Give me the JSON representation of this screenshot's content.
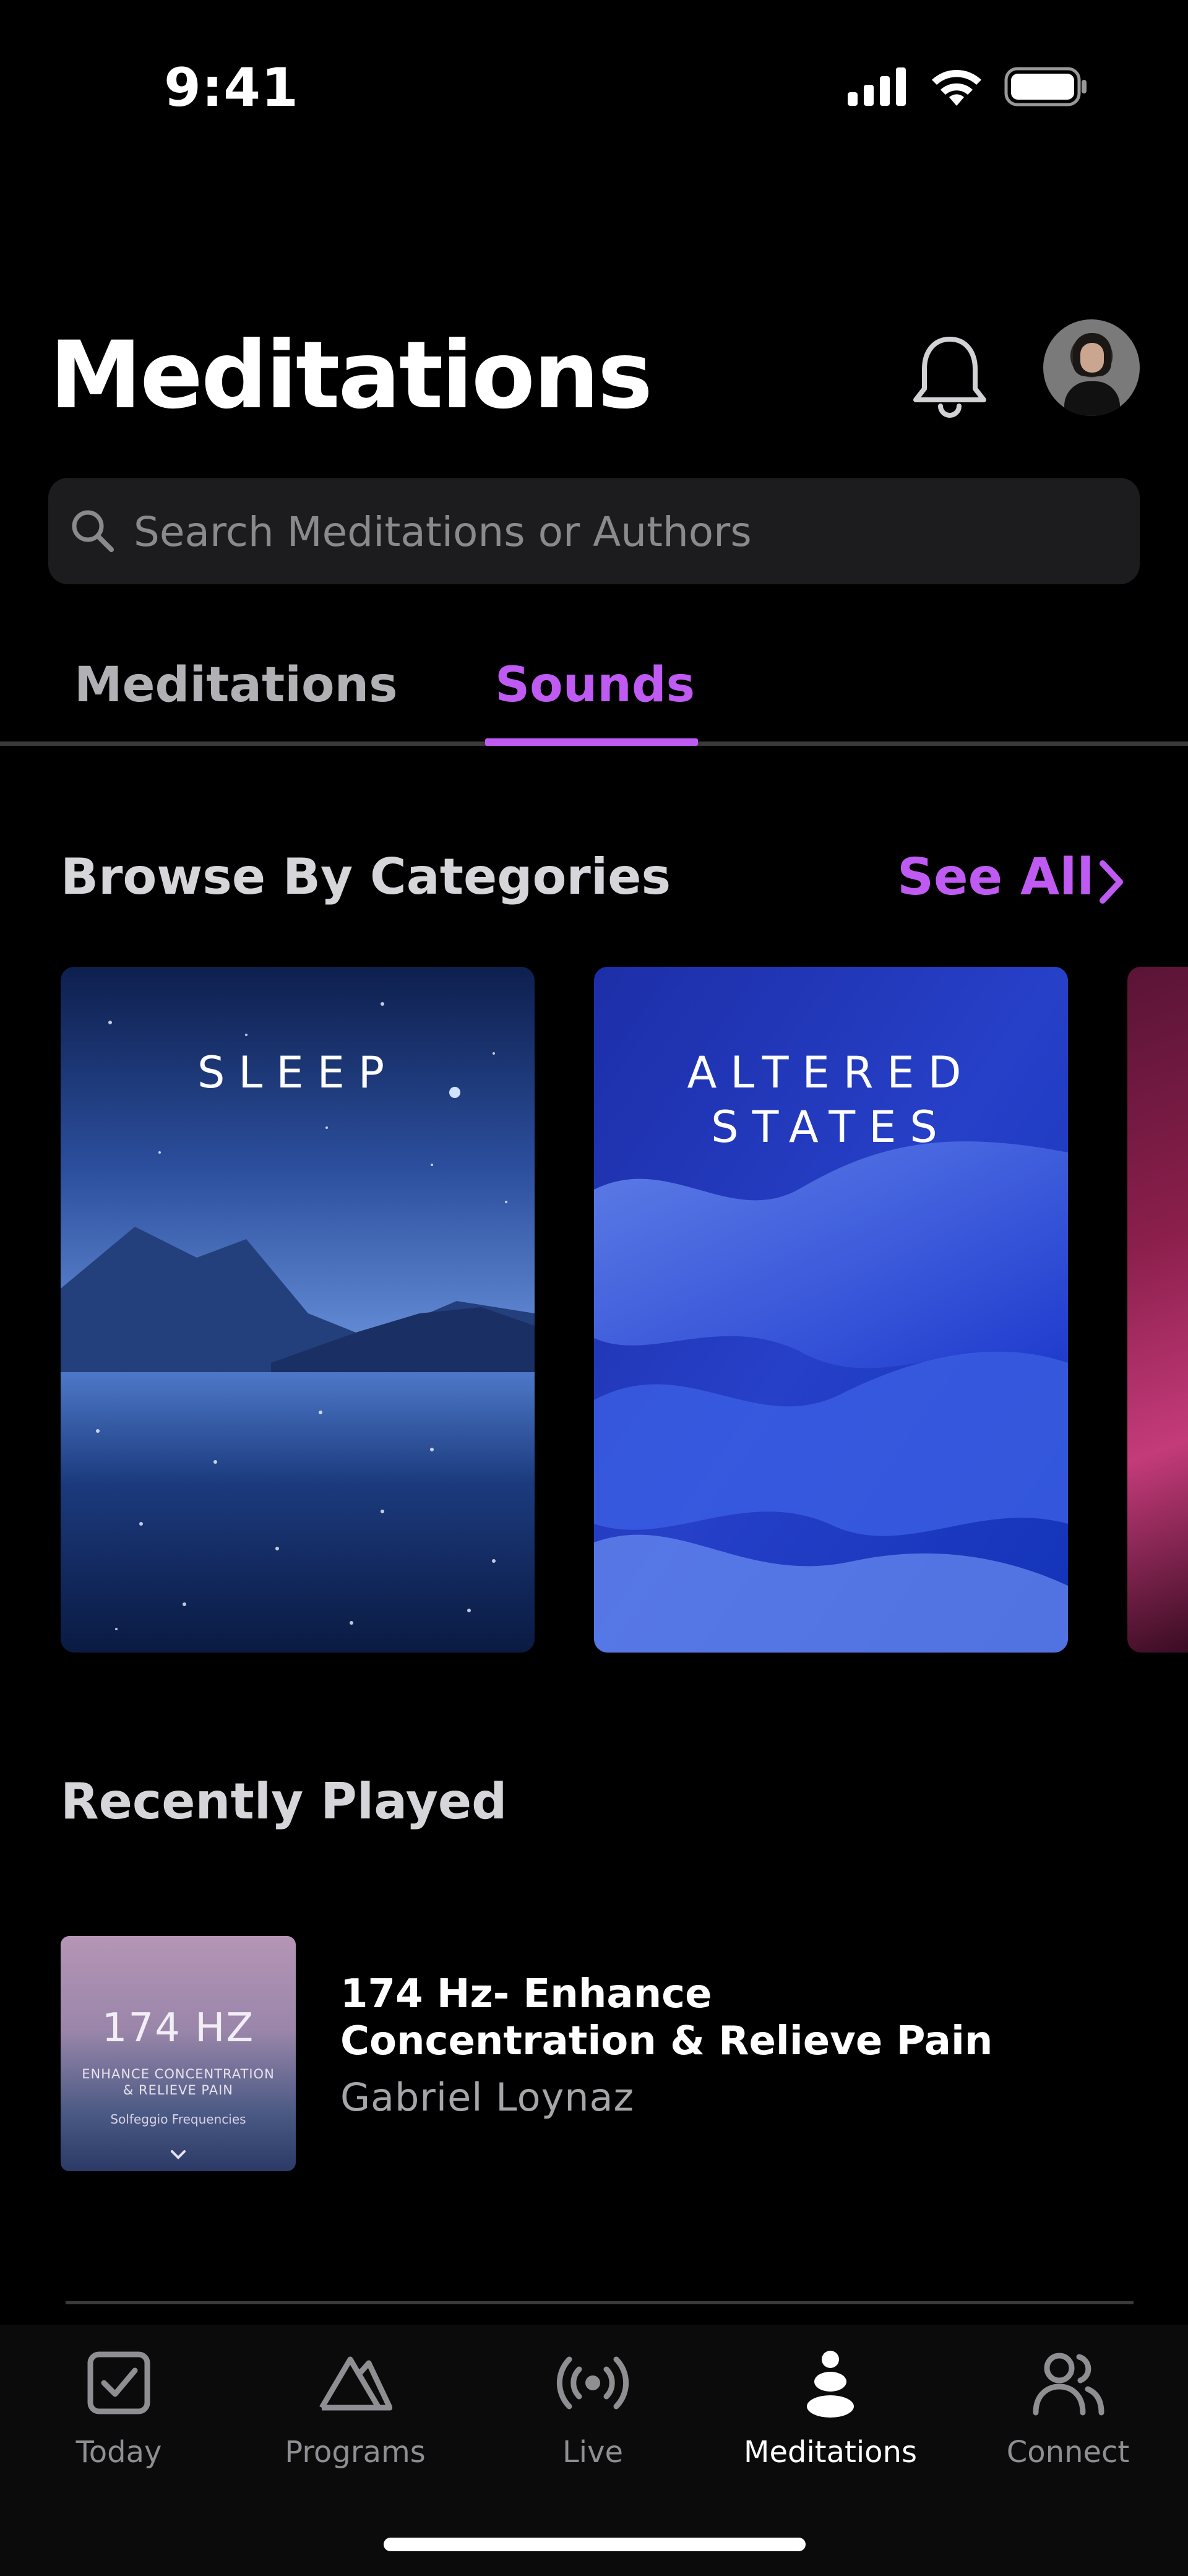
{
  "status_bar": {
    "time": "9:41"
  },
  "header": {
    "title": "Meditations"
  },
  "search": {
    "placeholder": "Search Meditations or Authors"
  },
  "tabs": [
    {
      "label": "Meditations",
      "active": false
    },
    {
      "label": "Sounds",
      "active": true
    }
  ],
  "browse": {
    "title": "Browse By Categories",
    "see_all": "See All",
    "categories": [
      {
        "label": "SLEEP"
      },
      {
        "label_line1": "ALTERED",
        "label_line2": "STATES"
      }
    ]
  },
  "recent": {
    "title": "Recently Played",
    "items": [
      {
        "thumb_title": "174 HZ",
        "thumb_subtitle_line1": "ENHANCE CONCENTRATION",
        "thumb_subtitle_line2": "& RELIEVE PAIN",
        "thumb_series": "Solfeggio Frequencies",
        "title": "174 Hz- Enhance Concentration & Relieve Pain",
        "author": "Gabriel Loynaz"
      }
    ]
  },
  "tab_bar": {
    "items": [
      {
        "label": "Today",
        "icon": "checkbox-icon",
        "active": false
      },
      {
        "label": "Programs",
        "icon": "mountain-icon",
        "active": false
      },
      {
        "label": "Live",
        "icon": "broadcast-icon",
        "active": false
      },
      {
        "label": "Meditations",
        "icon": "stacked-stones-icon",
        "active": true
      },
      {
        "label": "Connect",
        "icon": "people-icon",
        "active": false
      }
    ]
  },
  "colors": {
    "accent": "#bf5af2",
    "background": "#000000",
    "search_bg": "#1c1c1e"
  }
}
